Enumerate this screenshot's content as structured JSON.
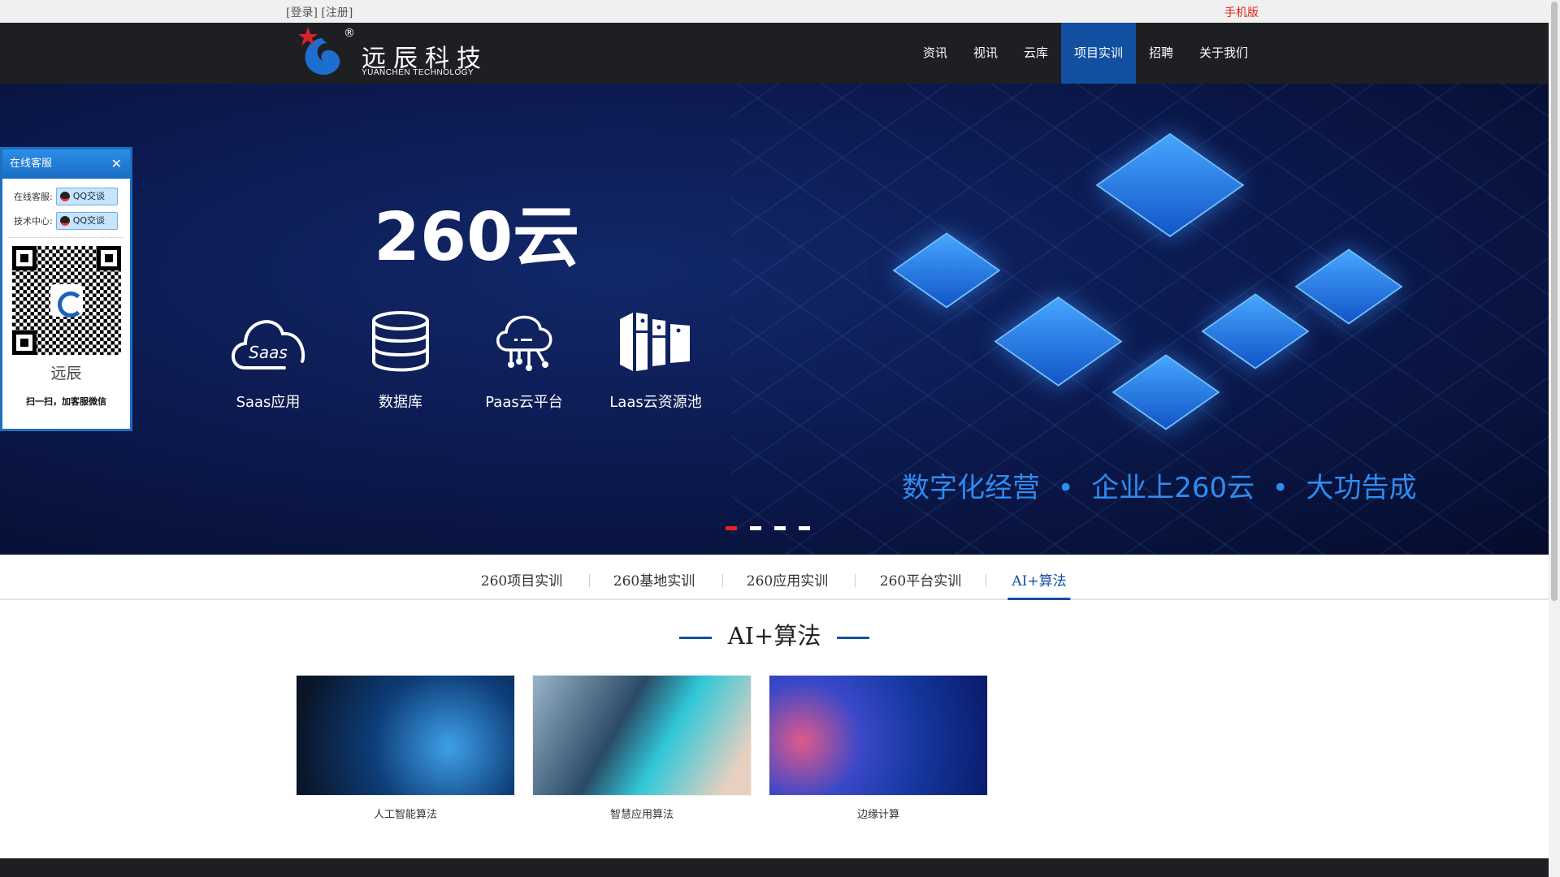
{
  "topbar": {
    "login": "[登录] [注册]",
    "mobile": "手机版"
  },
  "logo": {
    "cn": "远辰科技",
    "en": "YUANCHEN TECHNOLOGY",
    "reg": "®"
  },
  "nav": {
    "items": [
      "资讯",
      "视讯",
      "云库",
      "项目实训",
      "招聘",
      "关于我们"
    ],
    "active": 3
  },
  "banner": {
    "title": "260云",
    "features": [
      {
        "label": "Saas应用",
        "icon": "cloud-saas-icon"
      },
      {
        "label": "数据库",
        "icon": "database-icon"
      },
      {
        "label": "Paas云平台",
        "icon": "cloud-network-icon"
      },
      {
        "label": "Laas云资源池",
        "icon": "server-rack-icon"
      }
    ],
    "slogan": "数字化经营  •  企业上260云  •  大功告成",
    "slide_count": 4,
    "active_slide": 1
  },
  "service": {
    "title": "在线客服",
    "rows": [
      {
        "label": "在线客服:",
        "button": "QQ交谈"
      },
      {
        "label": "技术中心:",
        "button": "QQ交谈"
      }
    ],
    "name": "远辰",
    "tip": "扫一扫，加客服微信"
  },
  "tabs": {
    "items": [
      "260项目实训",
      "260基地实训",
      "260应用实训",
      "260平台实训",
      "AI+算法"
    ],
    "active": 4
  },
  "section": {
    "title": "AI+算法",
    "cards": [
      {
        "caption": "人工智能算法"
      },
      {
        "caption": "智慧应用算法"
      },
      {
        "caption": "边缘计算"
      }
    ]
  },
  "colors": {
    "accent": "#1150a0",
    "nav_bg": "#1e1f23",
    "slogan": "#2f8cf0",
    "red": "#e4231a"
  }
}
